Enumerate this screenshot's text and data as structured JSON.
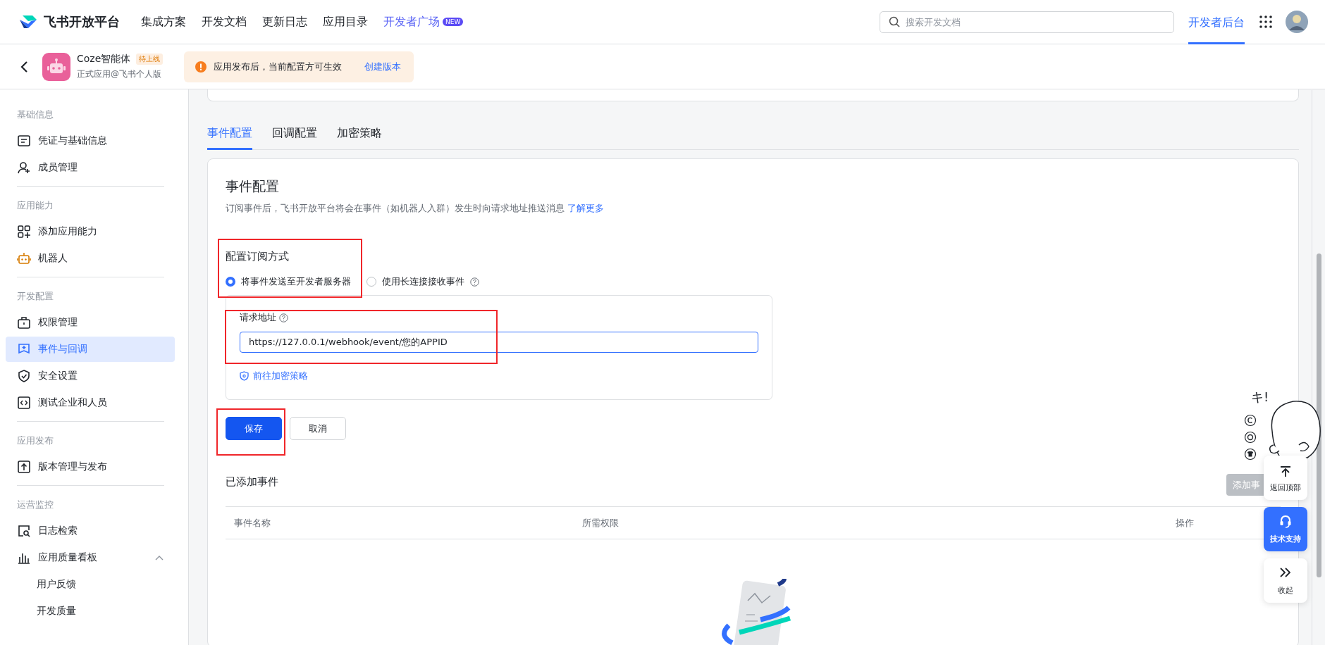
{
  "header": {
    "logo": "飞书开放平台",
    "nav": [
      {
        "label": "集成方案",
        "selected": false
      },
      {
        "label": "开发文档",
        "selected": false
      },
      {
        "label": "更新日志",
        "selected": false
      },
      {
        "label": "应用目录",
        "selected": false
      },
      {
        "label": "开发者广场",
        "selected": false,
        "badge": "NEW",
        "highlighted": true
      }
    ],
    "search": {
      "placeholder": "搜索开发文档"
    },
    "console": {
      "label": "开发者后台",
      "selected": true
    }
  },
  "app_bar": {
    "name": "Coze智能体",
    "status": "待上线",
    "subtitle": "正式应用@飞书个人版",
    "alert": "应用发布后，当前配置方可生效",
    "alert_link": "创建版本"
  },
  "sidebar": [
    {
      "title": "基础信息",
      "items": [
        {
          "label": "凭证与基础信息",
          "selected": false
        },
        {
          "label": "成员管理",
          "selected": false
        }
      ]
    },
    {
      "title": "应用能力",
      "items": [
        {
          "label": "添加应用能力",
          "selected": false
        },
        {
          "label": "机器人",
          "selected": false
        }
      ]
    },
    {
      "title": "开发配置",
      "items": [
        {
          "label": "权限管理",
          "selected": false
        },
        {
          "label": "事件与回调",
          "selected": true
        },
        {
          "label": "安全设置",
          "selected": false
        },
        {
          "label": "测试企业和人员",
          "selected": false
        }
      ]
    },
    {
      "title": "应用发布",
      "items": [
        {
          "label": "版本管理与发布",
          "selected": false
        }
      ]
    },
    {
      "title": "运营监控",
      "items": [
        {
          "label": "日志检索",
          "selected": false
        },
        {
          "label": "应用质量看板",
          "selected": false,
          "expanded": true,
          "children": [
            {
              "label": "用户反馈",
              "selected": false
            },
            {
              "label": "开发质量",
              "selected": false
            }
          ]
        }
      ]
    }
  ],
  "tabs": [
    {
      "label": "事件配置",
      "selected": true
    },
    {
      "label": "回调配置",
      "selected": false
    },
    {
      "label": "加密策略",
      "selected": false
    }
  ],
  "event_config": {
    "title": "事件配置",
    "description": "订阅事件后，飞书开放平台将会在事件（如机器人入群）发生时向请求地址推送消息",
    "learn_more": "了解更多",
    "subscription": {
      "title": "配置订阅方式",
      "options": [
        {
          "label": "将事件发送至开发者服务器",
          "selected": true,
          "help": false
        },
        {
          "label": "使用长连接接收事件",
          "selected": false,
          "help": true
        }
      ]
    },
    "request_url": {
      "label": "请求地址",
      "value": "https://127.0.0.1/webhook/event/您的APPID"
    },
    "encrypt_link": "前往加密策略",
    "save": "保存",
    "cancel": "取消"
  },
  "added_events": {
    "title": "已添加事件",
    "add_button": "添加事",
    "columns": [
      "事件名称",
      "所需权限",
      "操作"
    ]
  },
  "float_buttons": [
    {
      "kind": "top",
      "label": "返回顶部"
    },
    {
      "kind": "support",
      "label": "技术支持"
    },
    {
      "kind": "collapse",
      "label": "收起"
    }
  ],
  "sticker": {
    "text": "キ!"
  }
}
